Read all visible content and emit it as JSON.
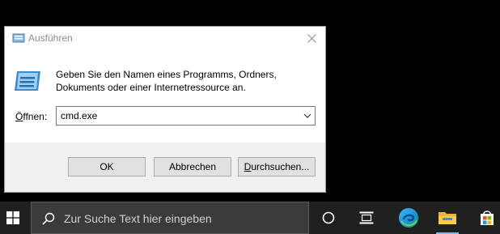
{
  "dialog": {
    "title": "Ausführen",
    "description_line1": "Geben Sie den Namen eines Programms, Ordners,",
    "description_line2": "Dokuments oder einer Internetressource an.",
    "open_label_first": "Ö",
    "open_label_rest": "ffnen:",
    "open_value": "cmd.exe",
    "ok_label": "OK",
    "cancel_label": "Abbrechen",
    "browse_label_first": "D",
    "browse_label_rest": "urchsuchen..."
  },
  "taskbar": {
    "search_placeholder": "Zur Suche Text hier eingeben",
    "icons": [
      "windows-start-icon",
      "search-icon",
      "cortana-icon",
      "task-view-icon",
      "edge-icon",
      "file-explorer-icon",
      "store-icon"
    ]
  },
  "colors": {
    "taskbar_bg": "#202020",
    "search_bg": "#3b3b3b",
    "dialog_footer": "#f0f0f0",
    "button_bg": "#e1e1e1"
  }
}
